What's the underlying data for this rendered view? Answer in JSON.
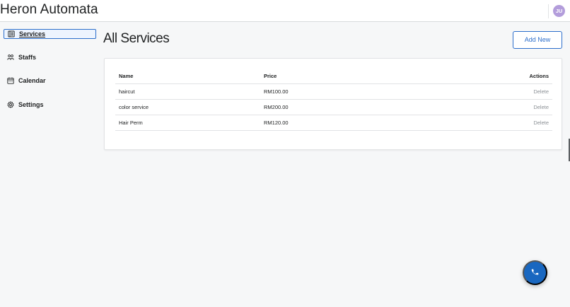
{
  "header": {
    "app_title": "Heron Automata",
    "avatar_initials": "JU"
  },
  "sidebar": {
    "items": [
      {
        "label": "Services",
        "icon": "list-icon",
        "active": true
      },
      {
        "label": "Staffs",
        "icon": "people-icon",
        "active": false
      },
      {
        "label": "Calendar",
        "icon": "calendar-icon",
        "active": false
      },
      {
        "label": "Settings",
        "icon": "gear-icon",
        "active": false
      }
    ]
  },
  "main": {
    "page_title": "All Services",
    "add_button_label": "Add New",
    "table": {
      "headers": {
        "name": "Name",
        "price": "Price",
        "actions": "Actions"
      },
      "rows": [
        {
          "name": "haircut",
          "price": "RM100.00",
          "action": "Delete"
        },
        {
          "name": "color service",
          "price": "RM200.00",
          "action": "Delete"
        },
        {
          "name": "Hair Perm",
          "price": "RM120.00",
          "action": "Delete"
        }
      ]
    }
  },
  "fab": {
    "icon": "phone-icon"
  },
  "colors": {
    "accent": "#2c6ecb",
    "fab": "#1967c0",
    "avatar": "#b39ddb",
    "background": "#f6f7f8"
  }
}
